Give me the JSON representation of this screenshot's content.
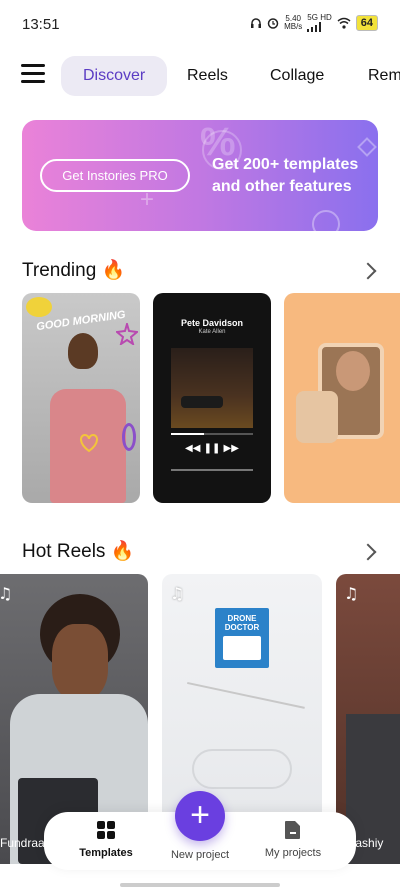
{
  "status": {
    "time": "13:51",
    "speed": "5.40",
    "speed_unit": "MB/s",
    "net_label": "5G HD",
    "battery": "64"
  },
  "nav": {
    "tabs": [
      "Discover",
      "Reels",
      "Collage",
      "Rem"
    ]
  },
  "promo": {
    "button_label": "Get Instories PRO",
    "text": "Get 200+ templates and other features"
  },
  "trending": {
    "title": "Trending 🔥",
    "cards": [
      {
        "overlay": "GOOD MORNING"
      },
      {
        "song": "Pete Davidson",
        "artist": "Kate Allen"
      },
      {
        "overlay": ""
      }
    ]
  },
  "hot_reels": {
    "title": "Hot Reels 🔥",
    "cards": [
      {
        "caption": "Fundraar"
      },
      {
        "logo_line1": "DRONE",
        "logo_line2": "DOCTOR"
      },
      {
        "caption": "Rdashiy"
      }
    ]
  },
  "bottom_nav": {
    "templates": "Templates",
    "new_project": "New project",
    "my_projects": "My projects"
  },
  "colors": {
    "accent": "#6a3fe0",
    "tab_active_bg": "#eceaf4"
  }
}
